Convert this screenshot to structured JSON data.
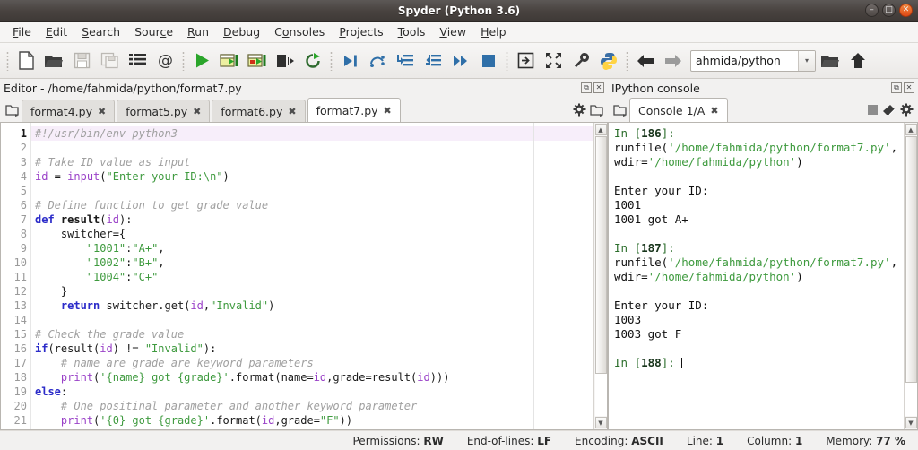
{
  "window": {
    "title": "Spyder (Python 3.6)",
    "minimize_label": "–",
    "maximize_label": "□",
    "close_label": "✕"
  },
  "menubar": {
    "items": [
      {
        "name": "file",
        "label": "File",
        "mnemonic": "F"
      },
      {
        "name": "edit",
        "label": "Edit",
        "mnemonic": "E"
      },
      {
        "name": "search",
        "label": "Search",
        "mnemonic": "S"
      },
      {
        "name": "source",
        "label": "Source",
        "mnemonic": "c"
      },
      {
        "name": "run",
        "label": "Run",
        "mnemonic": "R"
      },
      {
        "name": "debug",
        "label": "Debug",
        "mnemonic": "D"
      },
      {
        "name": "consoles",
        "label": "Consoles",
        "mnemonic": "o"
      },
      {
        "name": "projects",
        "label": "Projects",
        "mnemonic": "P"
      },
      {
        "name": "tools",
        "label": "Tools",
        "mnemonic": "T"
      },
      {
        "name": "view",
        "label": "View",
        "mnemonic": "V"
      },
      {
        "name": "help",
        "label": "Help",
        "mnemonic": "H"
      }
    ]
  },
  "toolbar": {
    "icons": [
      "new-file-icon",
      "open-file-icon",
      "save-file-icon",
      "save-all-icon",
      "file-switcher-icon",
      "find-symbol-icon",
      "run-file-icon",
      "run-cell-icon",
      "run-cell-advance-icon",
      "run-selection-icon",
      "re-run-icon",
      "debug-file-icon",
      "debug-step-over-icon",
      "debug-step-into-icon",
      "debug-step-return-icon",
      "debug-continue-icon",
      "debug-stop-icon",
      "maximize-pane-icon",
      "fullscreen-icon",
      "preferences-icon",
      "python-path-icon",
      "back-icon",
      "forward-icon",
      "browse-folder-icon",
      "parent-directory-icon"
    ],
    "path_value": "ahmida/python",
    "path_dropdown_label": "▾"
  },
  "editor": {
    "pane_title": "Editor - /home/fahmida/python/format7.py",
    "undock_label": "⧉",
    "close_label": "✕",
    "browse_tabs_icon": "browse-tabs-icon",
    "options_icon": "options-gear-icon",
    "tabs": [
      {
        "label": "format4.py",
        "active": false
      },
      {
        "label": "format5.py",
        "active": false
      },
      {
        "label": "format6.py",
        "active": false
      },
      {
        "label": "format7.py",
        "active": true
      }
    ],
    "tab_close_label": "✖",
    "current_line": 1,
    "lines": [
      {
        "n": 1,
        "tokens": [
          {
            "t": "cm",
            "v": "#!/usr/bin/env python3"
          }
        ]
      },
      {
        "n": 2,
        "tokens": []
      },
      {
        "n": 3,
        "tokens": [
          {
            "t": "cm",
            "v": "# Take ID value as input"
          }
        ]
      },
      {
        "n": 4,
        "tokens": [
          {
            "t": "bi",
            "v": "id"
          },
          {
            "t": "pl",
            "v": " = "
          },
          {
            "t": "bi",
            "v": "input"
          },
          {
            "t": "pl",
            "v": "("
          },
          {
            "t": "st",
            "v": "\"Enter your ID:\\n\""
          },
          {
            "t": "pl",
            "v": ")"
          }
        ]
      },
      {
        "n": 5,
        "tokens": []
      },
      {
        "n": 6,
        "tokens": [
          {
            "t": "cm",
            "v": "# Define function to get grade value"
          }
        ]
      },
      {
        "n": 7,
        "tokens": [
          {
            "t": "kw",
            "v": "def"
          },
          {
            "t": "pl",
            "v": " "
          },
          {
            "t": "fn",
            "v": "result"
          },
          {
            "t": "pl",
            "v": "("
          },
          {
            "t": "bi",
            "v": "id"
          },
          {
            "t": "pl",
            "v": "):"
          }
        ]
      },
      {
        "n": 8,
        "tokens": [
          {
            "t": "pl",
            "v": "    switcher={"
          }
        ]
      },
      {
        "n": 9,
        "tokens": [
          {
            "t": "pl",
            "v": "        "
          },
          {
            "t": "st",
            "v": "\"1001\""
          },
          {
            "t": "pl",
            "v": ":"
          },
          {
            "t": "st",
            "v": "\"A+\""
          },
          {
            "t": "pl",
            "v": ","
          }
        ]
      },
      {
        "n": 10,
        "tokens": [
          {
            "t": "pl",
            "v": "        "
          },
          {
            "t": "st",
            "v": "\"1002\""
          },
          {
            "t": "pl",
            "v": ":"
          },
          {
            "t": "st",
            "v": "\"B+\""
          },
          {
            "t": "pl",
            "v": ","
          }
        ]
      },
      {
        "n": 11,
        "tokens": [
          {
            "t": "pl",
            "v": "        "
          },
          {
            "t": "st",
            "v": "\"1004\""
          },
          {
            "t": "pl",
            "v": ":"
          },
          {
            "t": "st",
            "v": "\"C+\""
          }
        ]
      },
      {
        "n": 12,
        "tokens": [
          {
            "t": "pl",
            "v": "    }"
          }
        ]
      },
      {
        "n": 13,
        "tokens": [
          {
            "t": "pl",
            "v": "    "
          },
          {
            "t": "kw",
            "v": "return"
          },
          {
            "t": "pl",
            "v": " switcher.get("
          },
          {
            "t": "bi",
            "v": "id"
          },
          {
            "t": "pl",
            "v": ","
          },
          {
            "t": "st",
            "v": "\"Invalid\""
          },
          {
            "t": "pl",
            "v": ")"
          }
        ]
      },
      {
        "n": 14,
        "tokens": []
      },
      {
        "n": 15,
        "tokens": [
          {
            "t": "cm",
            "v": "# Check the grade value"
          }
        ]
      },
      {
        "n": 16,
        "tokens": [
          {
            "t": "kw",
            "v": "if"
          },
          {
            "t": "pl",
            "v": "(result("
          },
          {
            "t": "bi",
            "v": "id"
          },
          {
            "t": "pl",
            "v": ") != "
          },
          {
            "t": "st",
            "v": "\"Invalid\""
          },
          {
            "t": "pl",
            "v": "):"
          }
        ]
      },
      {
        "n": 17,
        "tokens": [
          {
            "t": "pl",
            "v": "    "
          },
          {
            "t": "cm",
            "v": "# name are grade are keyword parameters"
          }
        ]
      },
      {
        "n": 18,
        "tokens": [
          {
            "t": "pl",
            "v": "    "
          },
          {
            "t": "bi",
            "v": "print"
          },
          {
            "t": "pl",
            "v": "("
          },
          {
            "t": "st",
            "v": "'{name} got {grade}'"
          },
          {
            "t": "pl",
            "v": ".format(name="
          },
          {
            "t": "bi",
            "v": "id"
          },
          {
            "t": "pl",
            "v": ",grade=result("
          },
          {
            "t": "bi",
            "v": "id"
          },
          {
            "t": "pl",
            "v": ")))"
          }
        ]
      },
      {
        "n": 19,
        "tokens": [
          {
            "t": "kw",
            "v": "else"
          },
          {
            "t": "pl",
            "v": ":"
          }
        ]
      },
      {
        "n": 20,
        "tokens": [
          {
            "t": "pl",
            "v": "    "
          },
          {
            "t": "cm",
            "v": "# One positinal parameter and another keyword parameter"
          }
        ]
      },
      {
        "n": 21,
        "tokens": [
          {
            "t": "pl",
            "v": "    "
          },
          {
            "t": "bi",
            "v": "print"
          },
          {
            "t": "pl",
            "v": "("
          },
          {
            "t": "st",
            "v": "'{0} got {grade}'"
          },
          {
            "t": "pl",
            "v": ".format("
          },
          {
            "t": "bi",
            "v": "id"
          },
          {
            "t": "pl",
            "v": ",grade="
          },
          {
            "t": "st",
            "v": "\"F\""
          },
          {
            "t": "pl",
            "v": "))"
          }
        ]
      }
    ]
  },
  "console": {
    "pane_title": "IPython console",
    "undock_label": "⧉",
    "close_label": "✕",
    "tab_label": "Console 1/A",
    "tab_close_label": "✖",
    "options_icon": "options-gear-icon",
    "browse_tabs_icon": "browse-tabs-icon",
    "stop_icon": "stop-icon",
    "clear_icon": "eraser-icon",
    "gear_icon": "gear-icon",
    "blocks": [
      {
        "type": "in",
        "prompt_pre": "In [",
        "number": "186",
        "prompt_post": "]: ",
        "command_pre": "runfile(",
        "path1": "'/home/fahmida/python/format7.py'",
        "mid": ", wdir=",
        "path2": "'/home/fahmida/python'",
        "command_post": ")"
      },
      {
        "type": "blank"
      },
      {
        "type": "out",
        "text": "Enter your ID:"
      },
      {
        "type": "out",
        "text": "1001"
      },
      {
        "type": "out",
        "text": "1001 got A+"
      },
      {
        "type": "blank"
      },
      {
        "type": "in",
        "prompt_pre": "In [",
        "number": "187",
        "prompt_post": "]: ",
        "command_pre": "runfile(",
        "path1": "'/home/fahmida/python/format7.py'",
        "mid": ", wdir=",
        "path2": "'/home/fahmida/python'",
        "command_post": ")"
      },
      {
        "type": "blank"
      },
      {
        "type": "out",
        "text": "Enter your ID:"
      },
      {
        "type": "out",
        "text": "1003"
      },
      {
        "type": "out",
        "text": "1003 got F"
      },
      {
        "type": "blank"
      },
      {
        "type": "prompt",
        "prompt_pre": "In [",
        "number": "188",
        "prompt_post": "]: "
      }
    ]
  },
  "statusbar": {
    "items": [
      {
        "name": "permissions",
        "label": "Permissions:",
        "value": "RW"
      },
      {
        "name": "end-of-lines",
        "label": "End-of-lines:",
        "value": "LF"
      },
      {
        "name": "encoding",
        "label": "Encoding:",
        "value": "ASCII"
      },
      {
        "name": "line",
        "label": "Line:",
        "value": "1"
      },
      {
        "name": "column",
        "label": "Column:",
        "value": "1"
      },
      {
        "name": "memory",
        "label": "Memory:",
        "value": "77 %"
      }
    ]
  },
  "colors": {
    "titlebar": "#48423f",
    "accent_close": "#dd4814",
    "run_green": "#2aa52a",
    "debug_blue": "#2f6fa8",
    "string_green": "#3e9a3e",
    "keyword_blue": "#2c2cc9",
    "builtin_purple": "#9a42c8",
    "comment_gray": "#a0a0a0",
    "current_line_highlight": "#f7eefa"
  }
}
